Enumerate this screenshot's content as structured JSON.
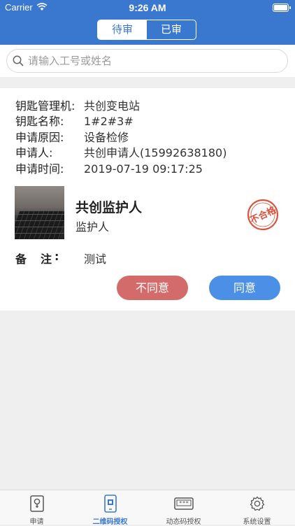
{
  "status_bar": {
    "carrier": "Carrier",
    "time": "9:26 AM"
  },
  "header": {
    "tabs": [
      "待审",
      "已审"
    ],
    "active_tab": "待审"
  },
  "search": {
    "placeholder": "请输入工号或姓名"
  },
  "record": {
    "rows": [
      {
        "label": "钥匙管理机:",
        "value": "共创变电站"
      },
      {
        "label": "钥匙名称:",
        "value": "1#2#3#"
      },
      {
        "label": "申请原因:",
        "value": "设备检修"
      },
      {
        "label": "申请人:",
        "value": "共创申请人(15992638180)"
      },
      {
        "label": "申请时间:",
        "value": "2019-07-19 09:17:25"
      }
    ],
    "person_name": "共创监护人",
    "person_role": "监护人",
    "stamp_text": "不合格",
    "remark_label": "备注",
    "remark_colon": ":",
    "remark_value": "测试",
    "reject_label": "不同意",
    "approve_label": "同意"
  },
  "tabbar": {
    "items": [
      {
        "label": "申请",
        "icon": "bulb-icon"
      },
      {
        "label": "二维码授权",
        "icon": "phone-qr-icon"
      },
      {
        "label": "动态码授权",
        "icon": "keypad-icon"
      },
      {
        "label": "系统设置",
        "icon": "gear-icon"
      }
    ],
    "active": "二维码授权"
  },
  "colors": {
    "primary": "#3a78cf",
    "reject": "#d36b6b",
    "approve": "#4b8fe6",
    "stamp": "#d9533e"
  }
}
